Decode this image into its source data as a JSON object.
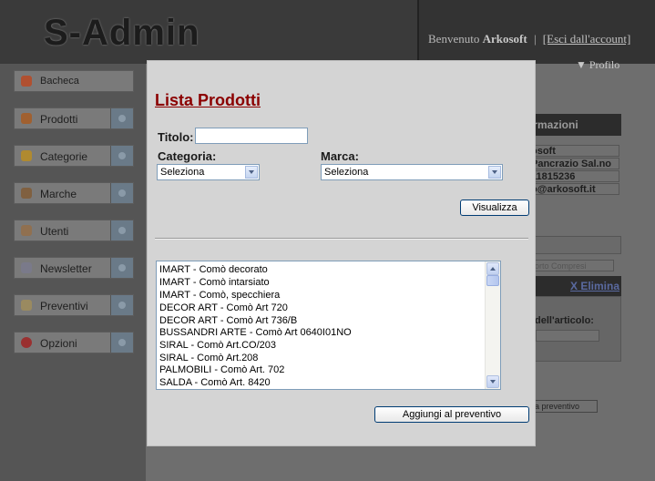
{
  "app": {
    "logo": "S-Admin",
    "welcome_prefix": "Benvenuto",
    "user": "Arkosoft",
    "separator": "|",
    "logout": "[Esci dall'account]",
    "profile": "▼ Profilo"
  },
  "sidebar": {
    "items": [
      {
        "label": "Bacheca",
        "icon": "home-icon",
        "color": "#b05030"
      },
      {
        "label": "Prodotti",
        "icon": "box-icon",
        "color": "#a06030"
      },
      {
        "label": "Categorie",
        "icon": "folder-icon",
        "color": "#b08a30"
      },
      {
        "label": "Marche",
        "icon": "users-icon",
        "color": "#806040"
      },
      {
        "label": "Utenti",
        "icon": "user-icon",
        "color": "#907050"
      },
      {
        "label": "Newsletter",
        "icon": "mail-icon",
        "color": "#7a7a8a"
      },
      {
        "label": "Preventivi",
        "icon": "pencil-icon",
        "color": "#9a8a60"
      },
      {
        "label": "Opzioni",
        "icon": "options-icon",
        "color": "#9a3030"
      }
    ]
  },
  "right_panel": {
    "header": "ormazioni",
    "line1": "osoft",
    "line2": "Pancrazio Sal.no",
    "line3": "11815236",
    "line4": "o@arkosoft.it",
    "small_field": "orto Compresi",
    "delete": "X Elimina",
    "article_label": "dell'articolo:",
    "bottom_button": "a preventivo"
  },
  "modal": {
    "title": "Lista Prodotti",
    "titolo_label": "Titolo:",
    "titolo_value": "",
    "categoria_label": "Categoria:",
    "categoria_value": "Seleziona",
    "marca_label": "Marca:",
    "marca_value": "Seleziona",
    "visualizza_button": "Visualizza",
    "products": [
      "IMART - Comò decorato",
      "IMART - Comò intarsiato",
      "IMART - Comò, specchiera",
      "DECOR ART - Comò Art 720",
      "DECOR ART - Comò Art 736/B",
      "BUSSANDRI ARTE - Comò Art 0640I01NO",
      "SIRAL - Comò Art.CO/203",
      "SIRAL - Comò Art.208",
      "PALMOBILI - Comò Art. 702",
      "SALDA - Comò Art. 8420"
    ],
    "add_button": "Aggiungi al preventivo"
  }
}
